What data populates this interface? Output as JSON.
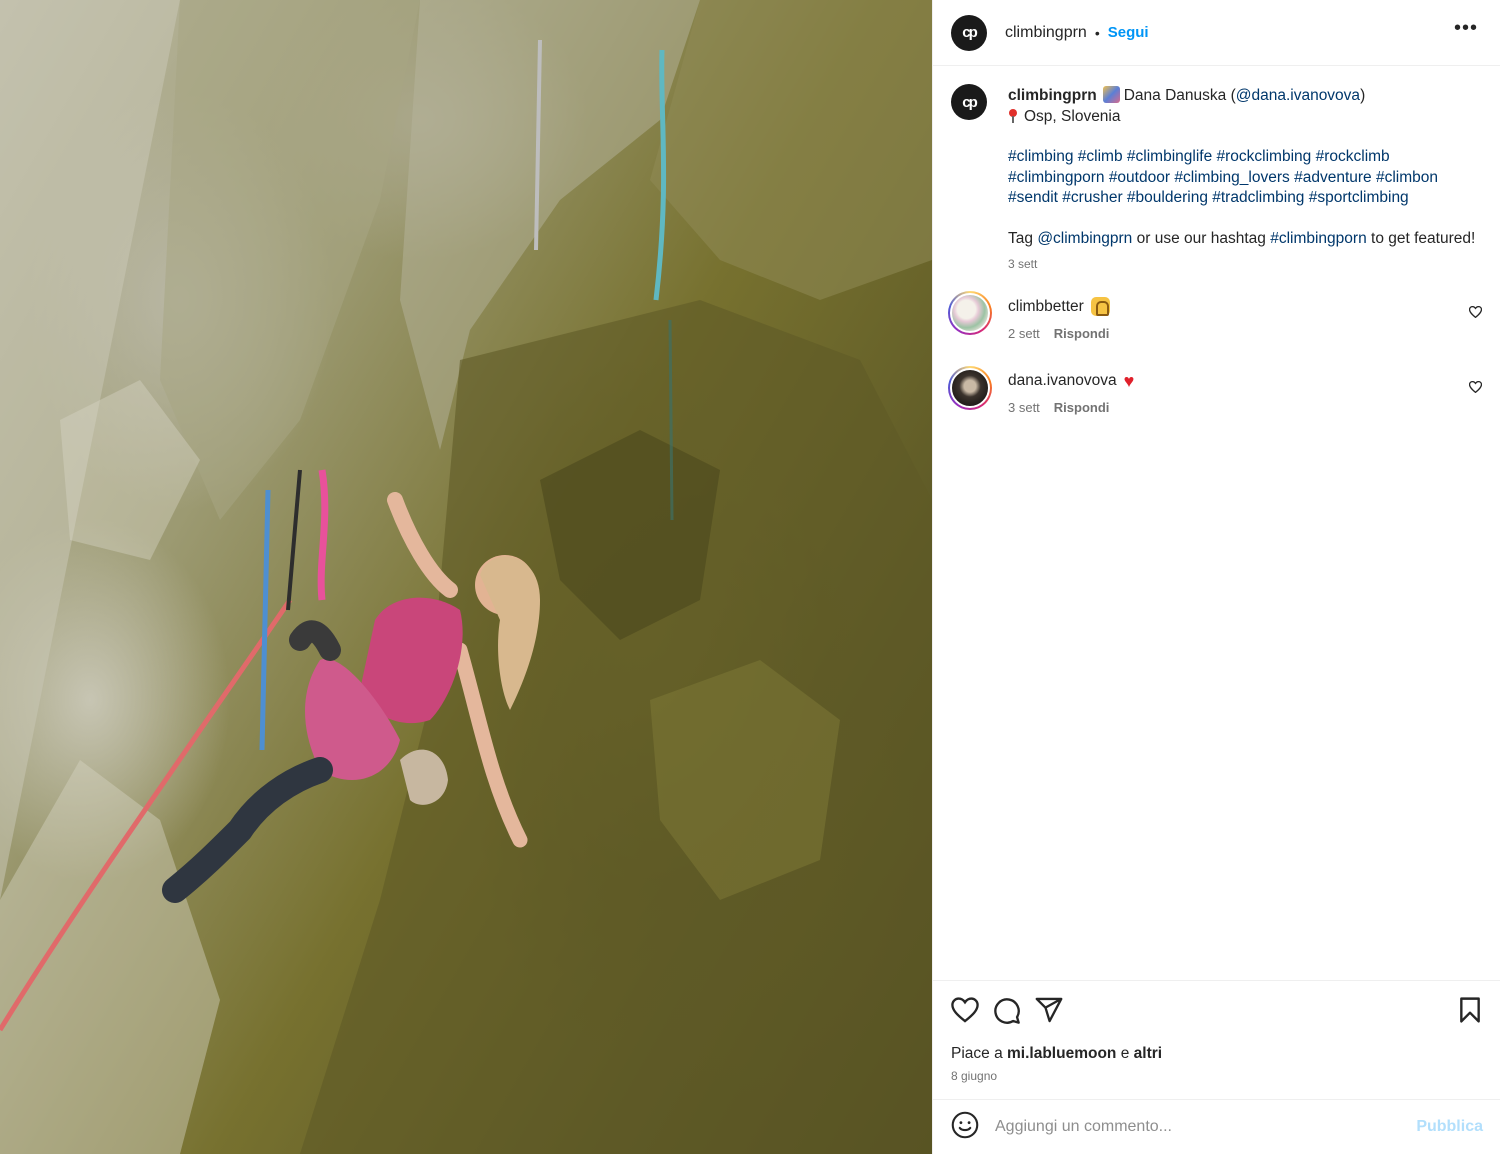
{
  "photo": {
    "description_icon": "climbing-photo"
  },
  "header": {
    "username": "climbingprn",
    "separator": "•",
    "follow_label": "Segui",
    "more_label": "•••",
    "avatar_text": "cp"
  },
  "caption": {
    "username": "climbingprn",
    "name": "Dana Danuska",
    "paren_open": "(",
    "mention": "@dana.ivanovova",
    "paren_close": ")",
    "location": "Osp, Slovenia",
    "hashtags_line1": [
      "#climbing",
      "#climb",
      "#climbinglife",
      "#rockclimbing",
      "#rockclimb"
    ],
    "hashtags_line2": [
      "#climbingporn",
      "#outdoor",
      "#climbing_lovers",
      "#adventure",
      "#climbon"
    ],
    "hashtags_line3": [
      "#sendit",
      "#crusher",
      "#bouldering",
      "#tradclimbing",
      "#sportclimbing"
    ],
    "tag_prefix": "Tag",
    "tag_mention": "@climbingprn",
    "tag_middle": "or use our hashtag",
    "tag_hashtag": "#climbingporn",
    "tag_suffix": "to get featured!",
    "time": "3 sett"
  },
  "comments": [
    {
      "username": "climbbetter",
      "time": "2 sett",
      "reply_label": "Rispondi"
    },
    {
      "username": "dana.ivanovova",
      "emoji": "♥",
      "time": "3 sett",
      "reply_label": "Rispondi"
    }
  ],
  "actions": {
    "likes_prefix": "Piace a",
    "likes_user": "mi.labluemoon",
    "likes_mid": "e",
    "likes_others": "altri",
    "date": "8 giugno"
  },
  "add_comment": {
    "placeholder": "Aggiungi un commento...",
    "publish_label": "Pubblica"
  }
}
